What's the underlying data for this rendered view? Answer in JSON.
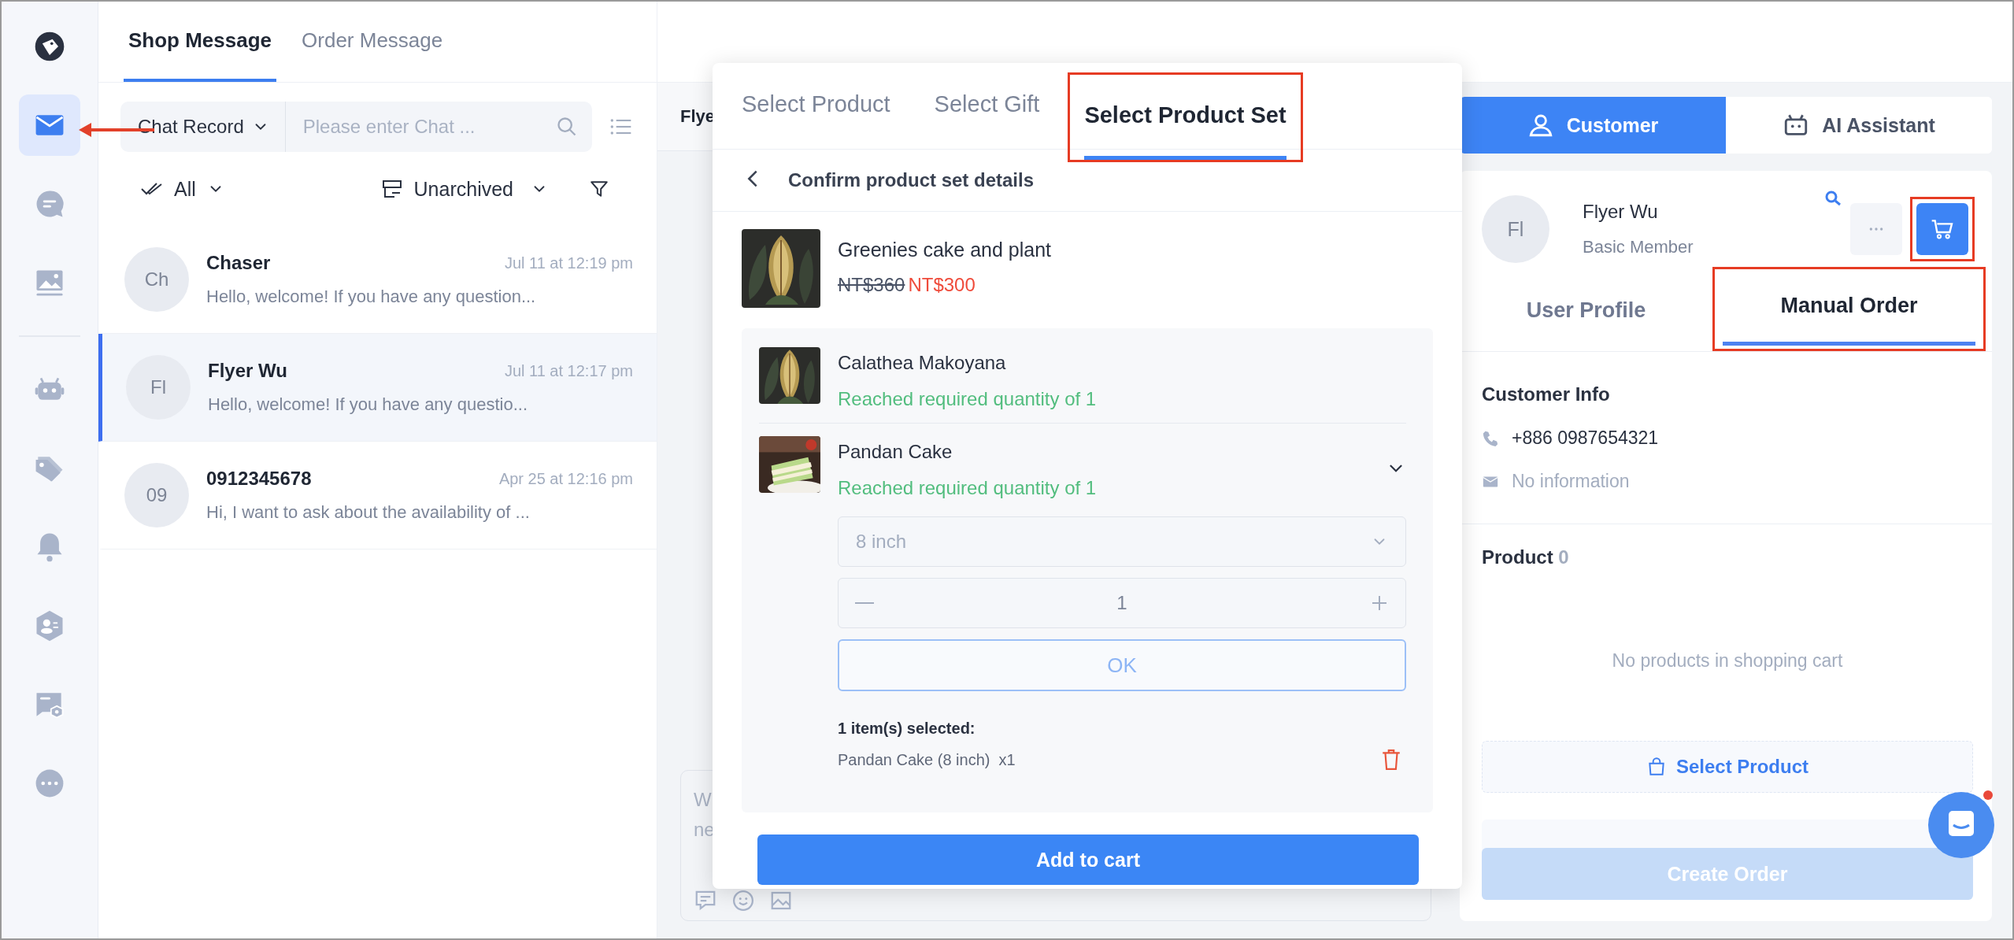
{
  "nav_items": [
    {
      "kind": "mail",
      "selected": true,
      "annotated": true
    },
    {
      "kind": "chat",
      "selected": false,
      "annotated": false
    },
    {
      "kind": "gallery",
      "selected": false,
      "annotated": false
    },
    {
      "kind": "robot",
      "selected": false,
      "annotated": false
    },
    {
      "kind": "tags",
      "selected": false,
      "annotated": false
    },
    {
      "kind": "bell",
      "selected": false,
      "annotated": false
    },
    {
      "kind": "contact",
      "selected": false,
      "annotated": false
    },
    {
      "kind": "card-settings",
      "selected": false,
      "annotated": false
    },
    {
      "kind": "more",
      "selected": false,
      "annotated": false
    }
  ],
  "message_tabs": [
    {
      "label": "Shop Message",
      "selected": true
    },
    {
      "label": "Order Message",
      "selected": false
    }
  ],
  "search": {
    "scope": "Chat Record",
    "placeholder": "Please enter Chat ..."
  },
  "filters": {
    "read": "All",
    "archive": "Unarchived"
  },
  "chats": [
    {
      "avatar": "Ch",
      "name": "Chaser",
      "time": "Jul 11 at 12:19 pm",
      "preview": "Hello, welcome! If you have any question...",
      "selected": false
    },
    {
      "avatar": "Fl",
      "name": "Flyer Wu",
      "time": "Jul 11 at 12:17 pm",
      "preview": "Hello, welcome! If you have any questio...",
      "selected": true
    },
    {
      "avatar": "09",
      "name": "0912345678",
      "time": "Apr 25 at 12:16 pm",
      "preview": "Hi, I want to ask about the availability of ...",
      "selected": false
    }
  ],
  "chat_header": {
    "name": "Flye"
  },
  "composer": {
    "lines": [
      "W",
      "ne"
    ]
  },
  "popup": {
    "tabs": [
      {
        "label": "Select Product",
        "selected": false,
        "annotated": false
      },
      {
        "label": "Select Gift",
        "selected": false,
        "annotated": false
      },
      {
        "label": "Select Product Set",
        "selected": true,
        "annotated": true
      }
    ],
    "back_title": "Confirm product set details",
    "set": {
      "name": "Greenies cake and plant",
      "old_price": "NT$360",
      "price": "NT$300"
    },
    "items": [
      {
        "name": "Calathea Makoyana",
        "status": "Reached required quantity of 1",
        "expanded": false,
        "kind": "plant"
      },
      {
        "name": "Pandan Cake",
        "status": "Reached required quantity of 1",
        "expanded": true,
        "kind": "cake",
        "variant": "8 inch",
        "quantity": "1",
        "confirm": "OK",
        "summary_title": "1 item(s) selected:",
        "summary_lines": [
          "Pandan Cake (8 inch)  x1"
        ]
      }
    ],
    "add_button": "Add to cart"
  },
  "mode_tabs": [
    {
      "label": "Customer",
      "kind": "person",
      "selected": true
    },
    {
      "label": "AI Assistant",
      "kind": "robot",
      "selected": false
    }
  ],
  "profile": {
    "avatar": "Fl",
    "name": "Flyer Wu",
    "membership": "Basic Member",
    "cart_annotated": true
  },
  "detail_tabs": [
    {
      "label": "User Profile",
      "selected": false,
      "annotated": false
    },
    {
      "label": "Manual Order",
      "selected": true,
      "annotated": true
    }
  ],
  "customer_info": {
    "title": "Customer Info",
    "phone": "+886 0987654321",
    "email": "No information"
  },
  "product": {
    "title": "Product",
    "count": "0",
    "empty": "No products in shopping cart"
  },
  "select_button": "Select Product",
  "create_button": {
    "label": "Create Order",
    "disabled": true
  }
}
